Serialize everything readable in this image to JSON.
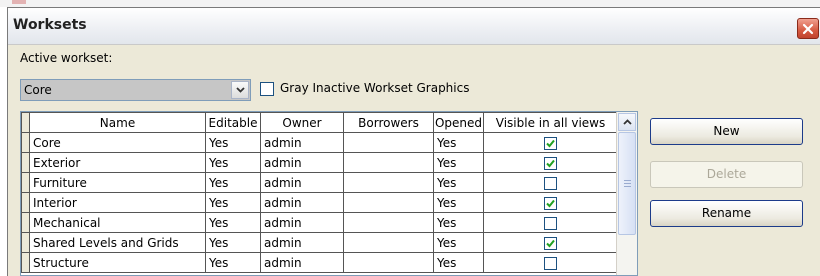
{
  "dialog": {
    "title": "Worksets",
    "active_workset_label": "Active workset:",
    "active_workset_value": "Core",
    "gray_inactive_label": "Gray Inactive Workset Graphics",
    "gray_inactive_checked": false
  },
  "grid": {
    "columns": [
      "Name",
      "Editable",
      "Owner",
      "Borrowers",
      "Opened",
      "Visible in all views"
    ],
    "rows": [
      {
        "name": "Core",
        "editable": "Yes",
        "owner": "admin",
        "borrowers": "",
        "opened": "Yes",
        "visible": true
      },
      {
        "name": "Exterior",
        "editable": "Yes",
        "owner": "admin",
        "borrowers": "",
        "opened": "Yes",
        "visible": true
      },
      {
        "name": "Furniture",
        "editable": "Yes",
        "owner": "admin",
        "borrowers": "",
        "opened": "Yes",
        "visible": false
      },
      {
        "name": "Interior",
        "editable": "Yes",
        "owner": "admin",
        "borrowers": "",
        "opened": "Yes",
        "visible": true
      },
      {
        "name": "Mechanical",
        "editable": "Yes",
        "owner": "admin",
        "borrowers": "",
        "opened": "Yes",
        "visible": false
      },
      {
        "name": "Shared Levels and Grids",
        "editable": "Yes",
        "owner": "admin",
        "borrowers": "",
        "opened": "Yes",
        "visible": true
      },
      {
        "name": "Structure",
        "editable": "Yes",
        "owner": "admin",
        "borrowers": "",
        "opened": "Yes",
        "visible": false
      }
    ]
  },
  "buttons": {
    "new": "New",
    "delete": "Delete",
    "delete_enabled": false,
    "rename": "Rename"
  },
  "icons": {
    "close": "close-icon",
    "dropdown": "chevron-down-icon",
    "scroll_up": "arrow-up-icon",
    "checkmark": "checkmark-icon"
  },
  "colors": {
    "dialog_bg": "#ece9d8",
    "close_red": "#d65a42",
    "check_green": "#21a121",
    "border_blue": "#7f9db9"
  }
}
